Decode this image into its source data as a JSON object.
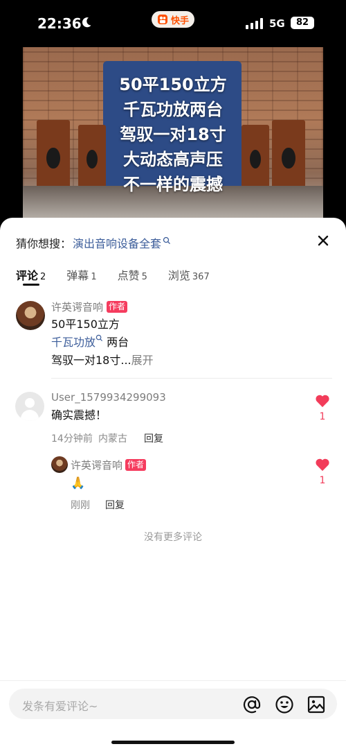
{
  "status_bar": {
    "time": "22:36",
    "network": "5G",
    "battery": "82",
    "app_name": "快手"
  },
  "video": {
    "caption_lines": [
      "50平150立方",
      "千瓦功放两台",
      "驾驭一对18寸",
      "大动态高声压",
      "不一样的震撼"
    ]
  },
  "header": {
    "guess_label": "猜你想搜：",
    "guess_link": "演出音响设备全套"
  },
  "tabs": [
    {
      "label": "评论",
      "count": "2"
    },
    {
      "label": "弹幕",
      "count": "1"
    },
    {
      "label": "点赞",
      "count": "5"
    },
    {
      "label": "浏览",
      "count": "367"
    }
  ],
  "post": {
    "author": "许英谔音响",
    "badge": "作者",
    "line1": "50平150立方",
    "line2_link": "千瓦功放",
    "line2_rest": " 两台",
    "line3": "驾驭一对18寸...",
    "expand": "展开"
  },
  "comments": [
    {
      "user": "User_1579934299093",
      "text": "确实震撼！",
      "time": "14分钟前",
      "location": "内蒙古",
      "reply": "回复",
      "likes": "1"
    }
  ],
  "reply": {
    "user": "许英谔音响",
    "badge": "作者",
    "text": "🙏",
    "time": "刚刚",
    "reply": "回复",
    "likes": "1"
  },
  "end_note": "没有更多评论",
  "input": {
    "placeholder": "发条有爱评论~"
  },
  "colors": {
    "accent": "#f53c5e",
    "link": "#3c5d9a",
    "like": "#f23c5a"
  }
}
